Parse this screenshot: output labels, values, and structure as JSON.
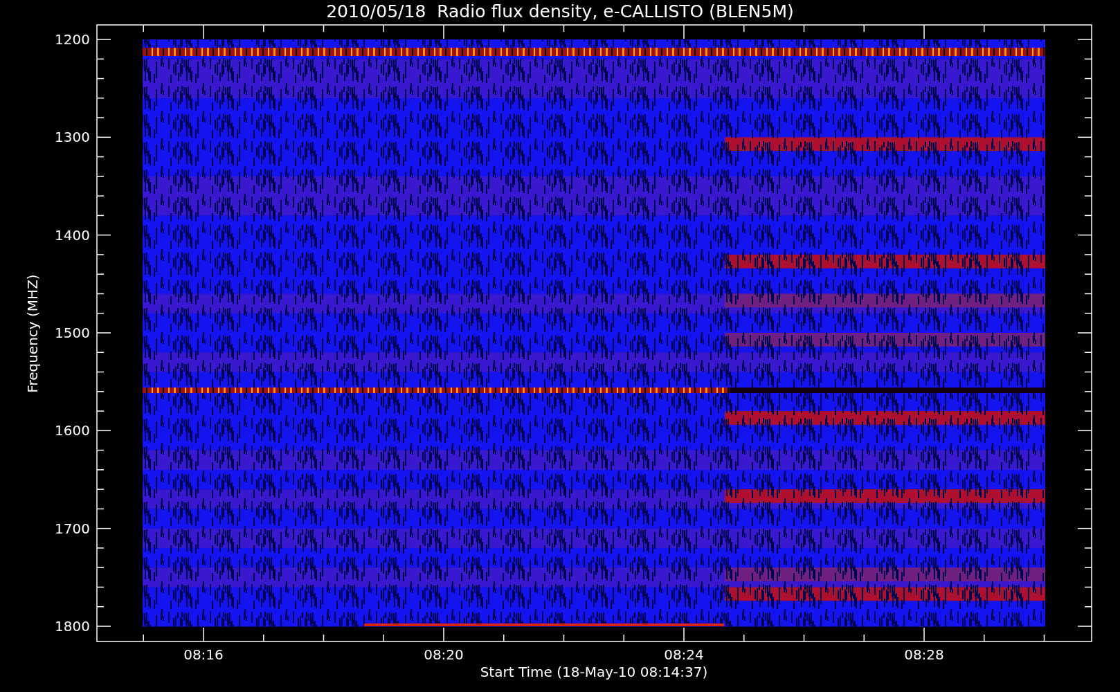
{
  "title": "2010/05/18  Radio flux density, e-CALLISTO (BLEN5M)",
  "y_axis": {
    "label": "Frequency (MHZ)",
    "ticks": [
      "1200",
      "1300",
      "1400",
      "1500",
      "1600",
      "1700",
      "1800"
    ]
  },
  "x_axis": {
    "label": "Start Time (18-May-10 08:14:37)",
    "ticks": [
      "08:16",
      "08:20",
      "08:24",
      "08:28"
    ]
  }
}
